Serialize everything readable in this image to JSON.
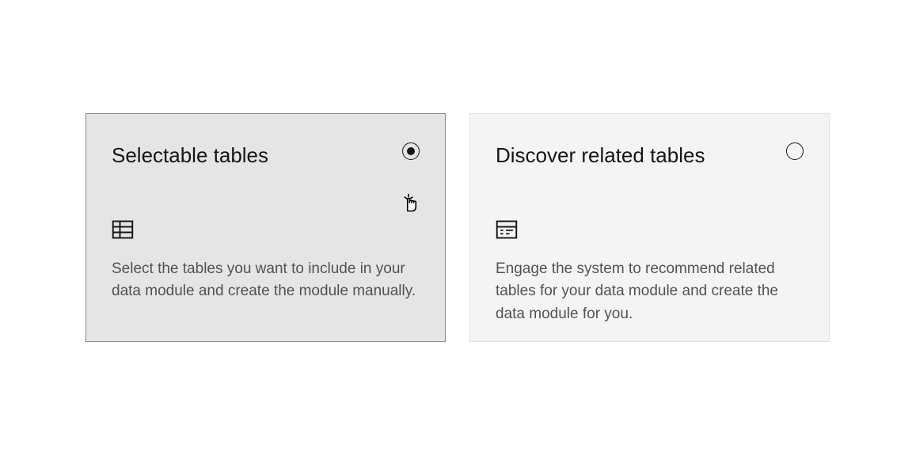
{
  "cards": [
    {
      "title": "Selectable tables",
      "description": "Select the tables you want to include in your data module and create the module manually.",
      "selected": true,
      "icon": "table-icon"
    },
    {
      "title": "Discover related tables",
      "description": "Engage the system to recommend related tables for your data module and create the data module for you.",
      "selected": false,
      "icon": "data-table-icon"
    }
  ]
}
